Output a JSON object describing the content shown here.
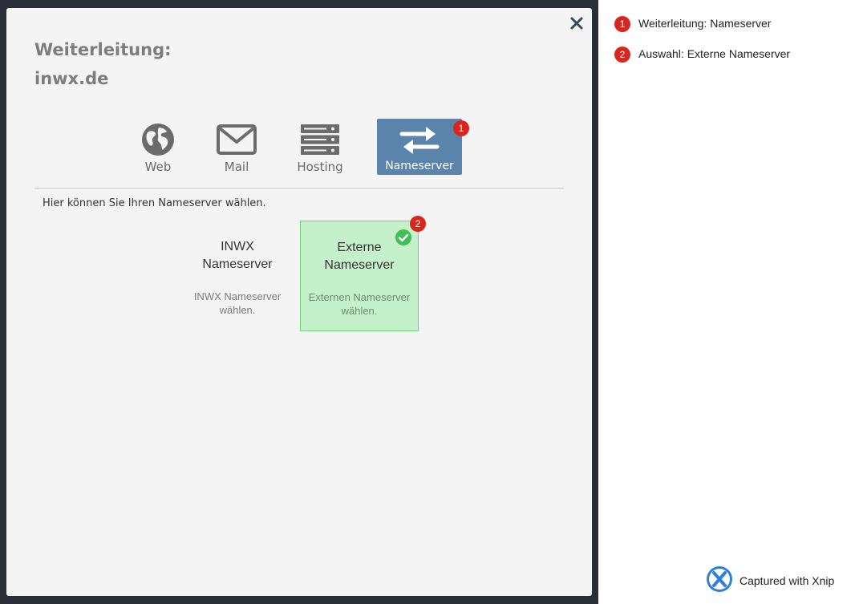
{
  "modal": {
    "title_line1": "Weiterleitung:",
    "title_line2": "inwx.de",
    "close_label": "×"
  },
  "tabs": [
    {
      "label": "Web",
      "icon": "globe-icon",
      "active": false
    },
    {
      "label": "Mail",
      "icon": "envelope-icon",
      "active": false
    },
    {
      "label": "Hosting",
      "icon": "server-icon",
      "active": false
    },
    {
      "label": "Nameserver",
      "icon": "arrows-exchange-icon",
      "active": true,
      "badge": "1"
    }
  ],
  "hint": "Hier können Sie Ihren Nameserver wählen.",
  "options": [
    {
      "title": "INWX Nameserver",
      "desc": "INWX Nameserver wählen.",
      "selected": false
    },
    {
      "title": "Externe Nameserver",
      "desc": "Externen Nameserver wählen.",
      "selected": true,
      "badge": "2"
    }
  ],
  "annotations": [
    {
      "number": "1",
      "text": "Weiterleitung: Nameserver"
    },
    {
      "number": "2",
      "text": "Auswahl: Externe Nameserver"
    }
  ],
  "footer": {
    "captured": "Captured with Xnip"
  },
  "colors": {
    "accent": "#5a84ac",
    "badge": "#d9261c",
    "selected_bg": "#c4f1c9",
    "check": "#3fbf55"
  }
}
